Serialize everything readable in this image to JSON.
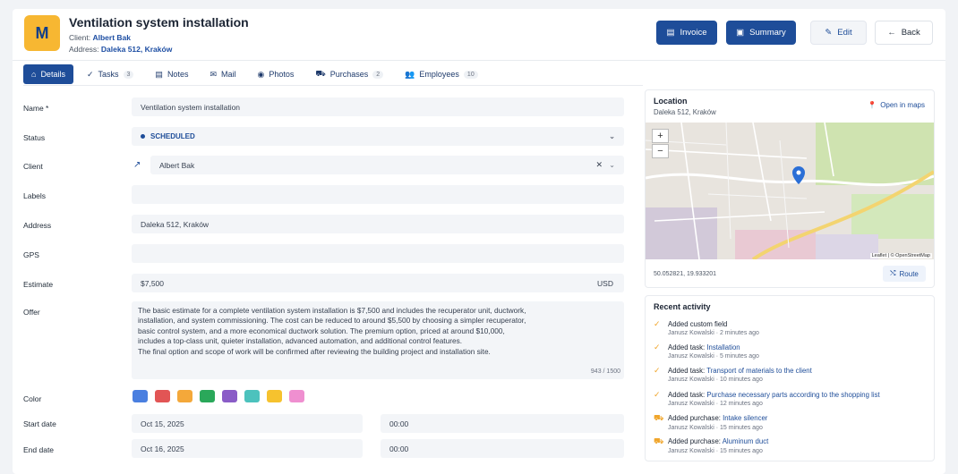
{
  "header": {
    "logo_letter": "M",
    "title": "Ventilation system installation",
    "client_label": "Client:",
    "client_name": "Albert Bak",
    "address_label": "Address:",
    "address_value": "Daleka 512, Kraków",
    "buttons": {
      "invoice": "Invoice",
      "summary": "Summary",
      "edit": "Edit",
      "back": "Back"
    }
  },
  "tabs": [
    {
      "label": "Details",
      "icon": "home-icon"
    },
    {
      "label": "Tasks",
      "count": "3",
      "icon": "check-icon"
    },
    {
      "label": "Notes",
      "icon": "notes-icon"
    },
    {
      "label": "Mail",
      "icon": "mail-icon"
    },
    {
      "label": "Photos",
      "icon": "camera-icon"
    },
    {
      "label": "Purchases",
      "count": "2",
      "icon": "cart-icon"
    },
    {
      "label": "Employees",
      "count": "10",
      "icon": "users-icon"
    }
  ],
  "form": {
    "name_label": "Name *",
    "name_value": "Ventilation system installation",
    "status_label": "Status",
    "status_value": "SCHEDULED",
    "client_label": "Client",
    "client_value": "Albert Bak",
    "labels_label": "Labels",
    "address_label": "Address",
    "address_value": "Daleka 512, Kraków",
    "gps_label": "GPS",
    "estimate_label": "Estimate",
    "estimate_value": "$7,500",
    "estimate_currency": "USD",
    "offer_label": "Offer",
    "offer_value": "The basic estimate for a complete ventilation system installation is $7,500 and includes the recuperator unit, ductwork,\ninstallation, and system commissioning. The cost can be reduced to around $5,500 by choosing a simpler recuperator,\nbasic control system, and a more economical ductwork solution. The premium option, priced at around $10,000,\nincludes a top-class unit, quieter installation, advanced automation, and additional control features.\nThe final option and scope of work will be confirmed after reviewing the building project and installation site.",
    "offer_count": "943 / 1500",
    "color_label": "Color",
    "colors": [
      "#4a7fe0",
      "#e25555",
      "#f4a83a",
      "#2aa85a",
      "#8a5cc7",
      "#4cc2bd",
      "#f6c22e",
      "#ef8fd0"
    ],
    "start_label": "Start date",
    "start_date": "Oct 15, 2025",
    "start_time": "00:00",
    "end_label": "End date",
    "end_date": "Oct 16, 2025",
    "end_time": "00:00"
  },
  "location": {
    "title": "Location",
    "address": "Daleka 512, Kraków",
    "open_maps": "Open in maps",
    "zoom_in": "+",
    "zoom_out": "−",
    "attribution": "Leaflet | © OpenStreetMap",
    "coords": "50.052821, 19.933201",
    "route": "Route"
  },
  "activity": {
    "title": "Recent activity",
    "items": [
      {
        "prefix": "Added custom field",
        "link": "",
        "meta": "Janusz Kowalski · 2 minutes ago",
        "icon": "check-icon"
      },
      {
        "prefix": "Added task:",
        "link": "Installation",
        "meta": "Janusz Kowalski · 5 minutes ago",
        "icon": "check-icon"
      },
      {
        "prefix": "Added task:",
        "link": "Transport of materials to the client",
        "meta": "Janusz Kowalski · 10 minutes ago",
        "icon": "check-icon"
      },
      {
        "prefix": "Added task:",
        "link": "Purchase necessary parts according to the shopping list",
        "meta": "Janusz Kowalski · 12 minutes ago",
        "icon": "check-icon"
      },
      {
        "prefix": "Added purchase:",
        "link": "Intake silencer",
        "meta": "Janusz Kowalski · 15 minutes ago",
        "icon": "cart-icon"
      },
      {
        "prefix": "Added purchase:",
        "link": "Aluminum duct",
        "meta": "Janusz Kowalski · 15 minutes ago",
        "icon": "cart-icon"
      }
    ]
  }
}
